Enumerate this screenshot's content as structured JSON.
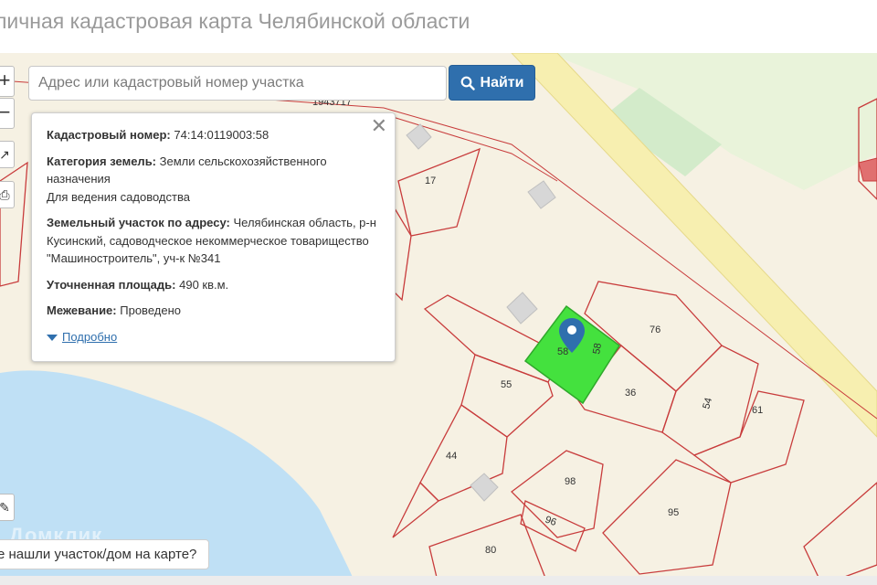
{
  "page_title": "личная кадастровая карта Челябинской области",
  "search": {
    "placeholder": "Адрес или кадастровый номер участка",
    "button_label": "Найти"
  },
  "map_controls": {
    "zoom_in": "+",
    "zoom_out": "−"
  },
  "popup": {
    "cadastral_number_label": "Кадастровый номер:",
    "cadastral_number": "74:14:0119003:58",
    "land_category_label": "Категория земель:",
    "land_category": "Земли сельскохозяйственного назначения",
    "land_use": "Для ведения садоводства",
    "address_label": "Земельный участок по адресу:",
    "address": "Челябинская область, р-н Кусинский, садоводческое некоммерческое товарищество \"Машиностроитель\", уч-к №341",
    "area_label": "Уточненная площадь:",
    "area": "490 кв.м.",
    "survey_label": "Межевание:",
    "survey": "Проведено",
    "more_link": "Подробно",
    "close_symbol": "✕"
  },
  "parcel_labels": {
    "p17": "17",
    "p76": "76",
    "p55": "55",
    "p36": "36",
    "p54": "54",
    "p61": "61",
    "p44": "44",
    "p98": "98",
    "p96": "96",
    "p95": "95",
    "p80": "80",
    "p58": "58",
    "p58b": "58",
    "top": "1943717"
  },
  "not_found_text": "е нашли участок/дом на карте?",
  "watermark": "Домклик",
  "colors": {
    "accent": "#2f6fad",
    "selected_parcel": "#44e13e",
    "water": "#bfe0f5",
    "road": "#f7f0b0",
    "parcel_border": "#c83c3c"
  }
}
